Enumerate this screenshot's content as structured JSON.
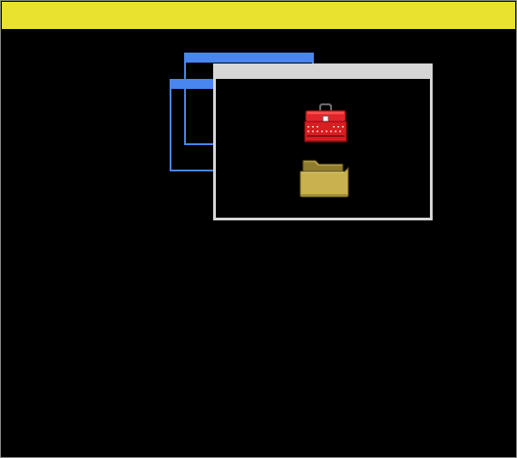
{
  "screen": {
    "background": "#000000",
    "top_bar_color": "#e9e22f"
  },
  "windows": {
    "outline_color": "#4a86f0",
    "front_frame_color": "#d6d6d6"
  },
  "icons": [
    {
      "name": "toolbox-icon",
      "color": "#e0262a"
    },
    {
      "name": "folder-icon",
      "color": "#c8b14e"
    }
  ]
}
